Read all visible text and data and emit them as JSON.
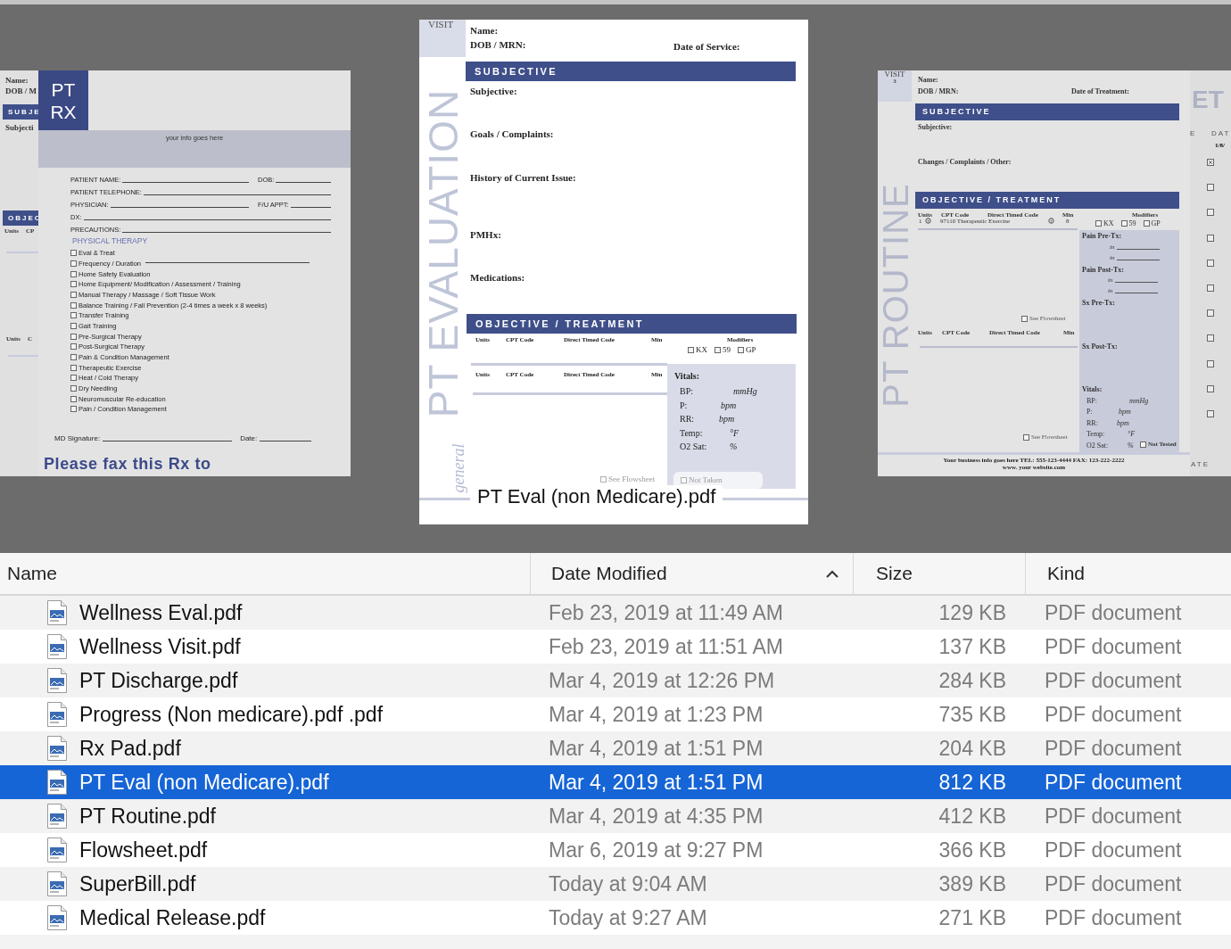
{
  "preview": {
    "back_page_left": {
      "name_label": "Name:",
      "dob_label": "DOB / M",
      "subjective_heading": "SUBJE",
      "subjective_label": "Subjecti",
      "objective_heading": "OBJEC",
      "code_columns_1": [
        "Units",
        "CP"
      ],
      "code_columns_2": [
        "Units",
        "C"
      ]
    },
    "rx_pad": {
      "logo_lines": [
        "PT",
        "RX"
      ],
      "info_text": "your info goes here",
      "form_rows": [
        [
          "PATIENT NAME:",
          "DOB:"
        ],
        [
          "PATIENT TELEPHONE:"
        ],
        [
          "PHYSICIAN:",
          "F/U APPT:"
        ],
        [
          "DX:"
        ],
        [
          "PRECAUTIONS:"
        ]
      ],
      "therapy_heading": "PHYSICAL THERAPY",
      "therapy_options": [
        {
          "label": "Eval & Treat",
          "checked": false,
          "kind": "plain"
        },
        {
          "label": "Frequency / Duration",
          "checked": false,
          "kind": "line"
        },
        {
          "label": "Home Safety Evaluation",
          "checked": false,
          "kind": "plain"
        },
        {
          "label": "Home Equipment/ Modification / Assessment / Training",
          "checked": false,
          "kind": "plain"
        },
        {
          "label": "Manual Therapy / Massage / Soft Tissue Work",
          "checked": false,
          "kind": "plain"
        },
        {
          "label": "Balance Training / Fall Prevention (2-4 times a week x 8 weeks)",
          "checked": false,
          "kind": "plain"
        },
        {
          "label": "Transfer Training",
          "checked": false,
          "kind": "plain"
        },
        {
          "label": "Gait Training",
          "checked": false,
          "kind": "plain"
        },
        {
          "label": "Pre-Surgical Therapy",
          "checked": false,
          "kind": "plain"
        },
        {
          "label": "Post-Surgical Therapy",
          "checked": false,
          "kind": "plain"
        },
        {
          "label": "Pain & Condition Management",
          "checked": false,
          "kind": "plain"
        },
        {
          "label": "Therapeutic Exercise",
          "checked": false,
          "kind": "plain"
        },
        {
          "label": "Heat / Cold Therapy",
          "checked": false,
          "kind": "plain"
        },
        {
          "label": "Dry Needling",
          "checked": false,
          "kind": "plain"
        },
        {
          "label": "Neuromuscular Re-education",
          "checked": false,
          "kind": "plain"
        },
        {
          "label": "Pain / Condition Management",
          "checked": false,
          "kind": "plain"
        }
      ],
      "signature_label": "MD Signature:",
      "date_label": "Date:",
      "fax_text": "Please fax this Rx to"
    },
    "center_page": {
      "visit_tab": "VISIT",
      "side_title": "PT EVALUATION",
      "side_script": "general",
      "name_label": "Name:",
      "dob_label": "DOB / MRN:",
      "date_label": "Date of Service:",
      "subjective_heading": "SUBJECTIVE",
      "subjective_fields": [
        "Subjective:",
        "Goals / Complaints:",
        "History of Current Issue:",
        "PMHx:",
        "Medications:"
      ],
      "objective_heading": "OBJECTIVE / TREATMENT",
      "code_tables": [
        {
          "columns": [
            "Units",
            "CPT Code",
            "Direct Timed Code",
            "Min"
          ]
        },
        {
          "columns": [
            "Units",
            "CPT Code",
            "Direct Timed Code",
            "Min"
          ]
        }
      ],
      "modifiers_label": "Modifiers",
      "modifiers": [
        {
          "label": "KX",
          "checked": false
        },
        {
          "label": "59",
          "checked": false
        },
        {
          "label": "GP",
          "checked": false
        }
      ],
      "vitals_title": "Vitals:",
      "vitals": [
        {
          "label": "BP:",
          "unit": "mmHg"
        },
        {
          "label": "P:",
          "unit": "bpm"
        },
        {
          "label": "RR:",
          "unit": "bpm"
        },
        {
          "label": "Temp:",
          "unit": "°F"
        },
        {
          "label": "O2 Sat:",
          "unit": "%"
        }
      ],
      "flowsheet_option": {
        "label": "See Flowsheet",
        "checked": false
      },
      "not_taken_option": {
        "label": "Not Taken",
        "checked": false
      }
    },
    "right_page": {
      "visit_tab": "VISIT",
      "visit_number": "3",
      "side_title": "PT ROUTINE",
      "name_label": "Name:",
      "dob_label": "DOB / MRN:",
      "date_label": "Date of Treatment:",
      "subjective_heading": "SUBJECTIVE",
      "subjective_fields": [
        "Subjective:",
        "Changes / Complaints / Other:"
      ],
      "objective_heading": "OBJECTIVE / TREATMENT",
      "code_tables": [
        {
          "columns": [
            "Units",
            "CPT Code",
            "Direct Timed Code",
            "Min"
          ]
        },
        {
          "columns": [
            "Units",
            "CPT Code",
            "Direct Timed Code",
            "Min"
          ]
        }
      ],
      "code_rows": [
        {
          "units": "1",
          "code": "97110 Therapeutic Exercise",
          "min": "8"
        }
      ],
      "modifiers_label": "Modifiers",
      "modifiers": [
        {
          "label": "KX",
          "checked": false
        },
        {
          "label": "59",
          "checked": false
        },
        {
          "label": "GP",
          "checked": false
        }
      ],
      "pain_pre_label": "Pain Pre-Tx:",
      "pain_pre_scales": [
        "in",
        "in"
      ],
      "pain_post_label": "Pain Post-Tx:",
      "pain_post_scales": [
        "in",
        "in"
      ],
      "sx_pre_label": "Sx Pre-Tx:",
      "sx_post_label": "Sx Post-Tx:",
      "vitals_title": "Vitals:",
      "vitals": [
        {
          "label": "BP:",
          "unit": "mmHg"
        },
        {
          "label": "P:",
          "unit": "bpm"
        },
        {
          "label": "RR:",
          "unit": "bpm"
        },
        {
          "label": "Temp:",
          "unit": "°F"
        },
        {
          "label": "O2 Sat:",
          "unit": "%"
        }
      ],
      "not_tested_option": {
        "label": "Not Tested",
        "checked": false
      },
      "flowsheet_options": [
        {
          "label": "See Flowsheet",
          "checked": false
        },
        {
          "label": "See Flowsheet",
          "checked": false
        }
      ],
      "footer_lines": [
        "Your business info goes here TEL: 555-123-4444 FAX: 123-222-2222",
        "www. your website.com"
      ]
    },
    "back_page_right": {
      "big_text": "ET",
      "heading_1": "E",
      "heading_2": "DAT",
      "date_text": "1/8/",
      "footer_heading": "ATE",
      "checkboxes": [
        {
          "checked": true
        },
        {
          "checked": false
        },
        {
          "checked": false
        },
        {
          "checked": false
        },
        {
          "checked": false
        },
        {
          "checked": false
        },
        {
          "checked": false
        },
        {
          "checked": false
        },
        {
          "checked": false
        },
        {
          "checked": false
        },
        {
          "checked": false
        }
      ]
    },
    "caption": "PT Eval (non Medicare).pdf"
  },
  "table": {
    "columns": [
      {
        "label": "Name",
        "sorted": false
      },
      {
        "label": "Date Modified",
        "sorted": true
      },
      {
        "label": "Size",
        "sorted": false
      },
      {
        "label": "Kind",
        "sorted": false
      }
    ],
    "rows": [
      {
        "name": "Wellness Eval.pdf",
        "date": "Feb 23, 2019 at 11:49 AM",
        "size": "129 KB",
        "kind": "PDF document",
        "selected": false
      },
      {
        "name": "Wellness Visit.pdf",
        "date": "Feb 23, 2019 at 11:51 AM",
        "size": "137 KB",
        "kind": "PDF document",
        "selected": false
      },
      {
        "name": "PT Discharge.pdf",
        "date": "Mar 4, 2019 at 12:26 PM",
        "size": "284 KB",
        "kind": "PDF document",
        "selected": false
      },
      {
        "name": "Progress (Non medicare).pdf .pdf",
        "date": "Mar 4, 2019 at 1:23 PM",
        "size": "735 KB",
        "kind": "PDF document",
        "selected": false
      },
      {
        "name": "Rx Pad.pdf",
        "date": "Mar 4, 2019 at 1:51 PM",
        "size": "204 KB",
        "kind": "PDF document",
        "selected": false
      },
      {
        "name": "PT Eval (non Medicare).pdf",
        "date": "Mar 4, 2019 at 1:51 PM",
        "size": "812 KB",
        "kind": "PDF document",
        "selected": true
      },
      {
        "name": "PT Routine.pdf",
        "date": "Mar 4, 2019 at 4:35 PM",
        "size": "412 KB",
        "kind": "PDF document",
        "selected": false
      },
      {
        "name": "Flowsheet.pdf",
        "date": "Mar 6, 2019 at 9:27 PM",
        "size": "366 KB",
        "kind": "PDF document",
        "selected": false
      },
      {
        "name": "SuperBill.pdf",
        "date": "Today at 9:04 AM",
        "size": "389 KB",
        "kind": "PDF document",
        "selected": false
      },
      {
        "name": "Medical Release.pdf",
        "date": "Today at 9:27 AM",
        "size": "271 KB",
        "kind": "PDF document",
        "selected": false
      }
    ]
  }
}
